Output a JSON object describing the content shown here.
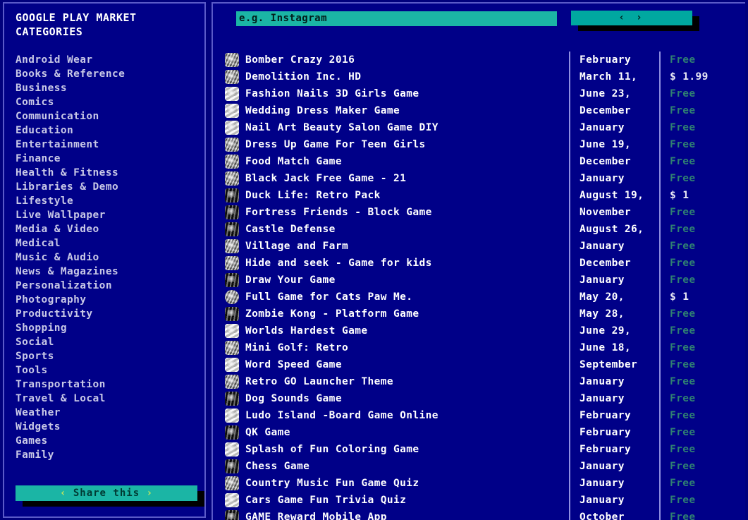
{
  "theme": {
    "page_bg": "#00007c",
    "panel_bg": "#000088",
    "panel_border": "#5a5ac8",
    "accent_teal": "#1bb5a5",
    "accent_teal_dark": "#00a8a0",
    "text_primary": "#ffffff",
    "text_category": "#c8c8e6",
    "price_free": "#2f7f72",
    "divider": "#8f8fe0",
    "share_chevron": "#c8e65a"
  },
  "sidebar": {
    "title_line1": "GOOGLE PLAY MARKET",
    "title_line2": "CATEGORIES",
    "categories": [
      "Android Wear",
      "Books & Reference",
      "Business",
      "Comics",
      "Communication",
      "Education",
      "Entertainment",
      "Finance",
      "Health & Fitness",
      "Libraries & Demo",
      "Lifestyle",
      "Live Wallpaper",
      "Media & Video",
      "Medical",
      "Music & Audio",
      "News & Magazines",
      "Personalization",
      "Photography",
      "Productivity",
      "Shopping",
      "Social",
      "Sports",
      "Tools",
      "Transportation",
      "Travel & Local",
      "Weather",
      "Widgets",
      "Games",
      "Family"
    ],
    "share_button": {
      "left_chevron": "‹",
      "label": "Share this",
      "right_chevron": "›"
    }
  },
  "topbar": {
    "search": {
      "value": "",
      "placeholder": "e.g. Instagram",
      "icon": "search-icon"
    },
    "nav_button": {
      "label": "‹ ›",
      "prev_icon": "chevron-left-icon",
      "next_icon": "chevron-right-icon"
    }
  },
  "table": {
    "rows": [
      {
        "icon": "app-icon",
        "tile": "mid",
        "name": "Bomber Crazy 2016",
        "date": "February",
        "price": "Free"
      },
      {
        "icon": "app-icon",
        "tile": "mid",
        "name": "Demolition Inc. HD",
        "date": "March 11,",
        "price": "$ 1.99"
      },
      {
        "icon": "app-icon",
        "tile": "lt",
        "name": "Fashion Nails 3D Girls Game",
        "date": "June 23,",
        "price": "Free"
      },
      {
        "icon": "app-icon",
        "tile": "lt",
        "name": "Wedding Dress Maker Game",
        "date": "December",
        "price": "Free"
      },
      {
        "icon": "app-icon",
        "tile": "lt",
        "name": "Nail Art Beauty Salon Game DIY",
        "date": "January",
        "price": "Free"
      },
      {
        "icon": "app-icon",
        "tile": "mid",
        "name": "Dress Up Game For Teen Girls",
        "date": "June 19,",
        "price": "Free"
      },
      {
        "icon": "app-icon",
        "tile": "mid",
        "name": "Food Match Game",
        "date": "December",
        "price": "Free"
      },
      {
        "icon": "app-icon",
        "tile": "mid",
        "name": "Black Jack Free Game - 21",
        "date": "January",
        "price": "Free"
      },
      {
        "icon": "app-icon",
        "tile": "dk",
        "name": "Duck Life: Retro Pack",
        "date": "August 19,",
        "price": "$ 1"
      },
      {
        "icon": "app-icon",
        "tile": "dk",
        "name": "Fortress Friends - Block Game",
        "date": "November",
        "price": "Free"
      },
      {
        "icon": "app-icon",
        "tile": "dk",
        "name": "Castle Defense",
        "date": "August 26,",
        "price": "Free"
      },
      {
        "icon": "app-icon",
        "tile": "mid",
        "name": "Village and Farm",
        "date": "January",
        "price": "Free"
      },
      {
        "icon": "app-icon",
        "tile": "mid",
        "name": "Hide and seek - Game for kids",
        "date": "December",
        "price": "Free"
      },
      {
        "icon": "app-icon",
        "tile": "dk",
        "name": "Draw Your Game",
        "date": "January",
        "price": "Free"
      },
      {
        "icon": "app-icon",
        "tile": "rnd",
        "name": "Full Game for Cats Paw Me.",
        "date": "May 20,",
        "price": "$ 1"
      },
      {
        "icon": "app-icon",
        "tile": "dk",
        "name": "Zombie Kong - Platform Game",
        "date": "May 28,",
        "price": "Free"
      },
      {
        "icon": "app-icon",
        "tile": "lt",
        "name": "Worlds Hardest Game",
        "date": "June 29,",
        "price": "Free"
      },
      {
        "icon": "app-icon",
        "tile": "mid",
        "name": "Mini Golf: Retro",
        "date": "June 18,",
        "price": "Free"
      },
      {
        "icon": "app-icon",
        "tile": "lt",
        "name": "Word Speed Game",
        "date": "September",
        "price": "Free"
      },
      {
        "icon": "app-icon",
        "tile": "mid",
        "name": "Retro GO Launcher Theme",
        "date": "January",
        "price": "Free"
      },
      {
        "icon": "app-icon",
        "tile": "dk",
        "name": "Dog Sounds Game",
        "date": "January",
        "price": "Free"
      },
      {
        "icon": "app-icon",
        "tile": "lt",
        "name": "Ludo Island -Board Game Online",
        "date": "February",
        "price": "Free"
      },
      {
        "icon": "app-icon",
        "tile": "dk",
        "name": "QK Game",
        "date": "February",
        "price": "Free"
      },
      {
        "icon": "app-icon",
        "tile": "lt",
        "name": "Splash of Fun Coloring Game",
        "date": "February",
        "price": "Free"
      },
      {
        "icon": "app-icon",
        "tile": "dk",
        "name": "Chess Game",
        "date": "January",
        "price": "Free"
      },
      {
        "icon": "app-icon",
        "tile": "mid",
        "name": "Country Music Fun Game Quiz",
        "date": "January",
        "price": "Free"
      },
      {
        "icon": "app-icon",
        "tile": "lt",
        "name": "Cars Game Fun Trivia Quiz",
        "date": "January",
        "price": "Free"
      },
      {
        "icon": "app-icon",
        "tile": "dk",
        "name": "GAME Reward Mobile App",
        "date": "October",
        "price": "Free"
      }
    ]
  }
}
